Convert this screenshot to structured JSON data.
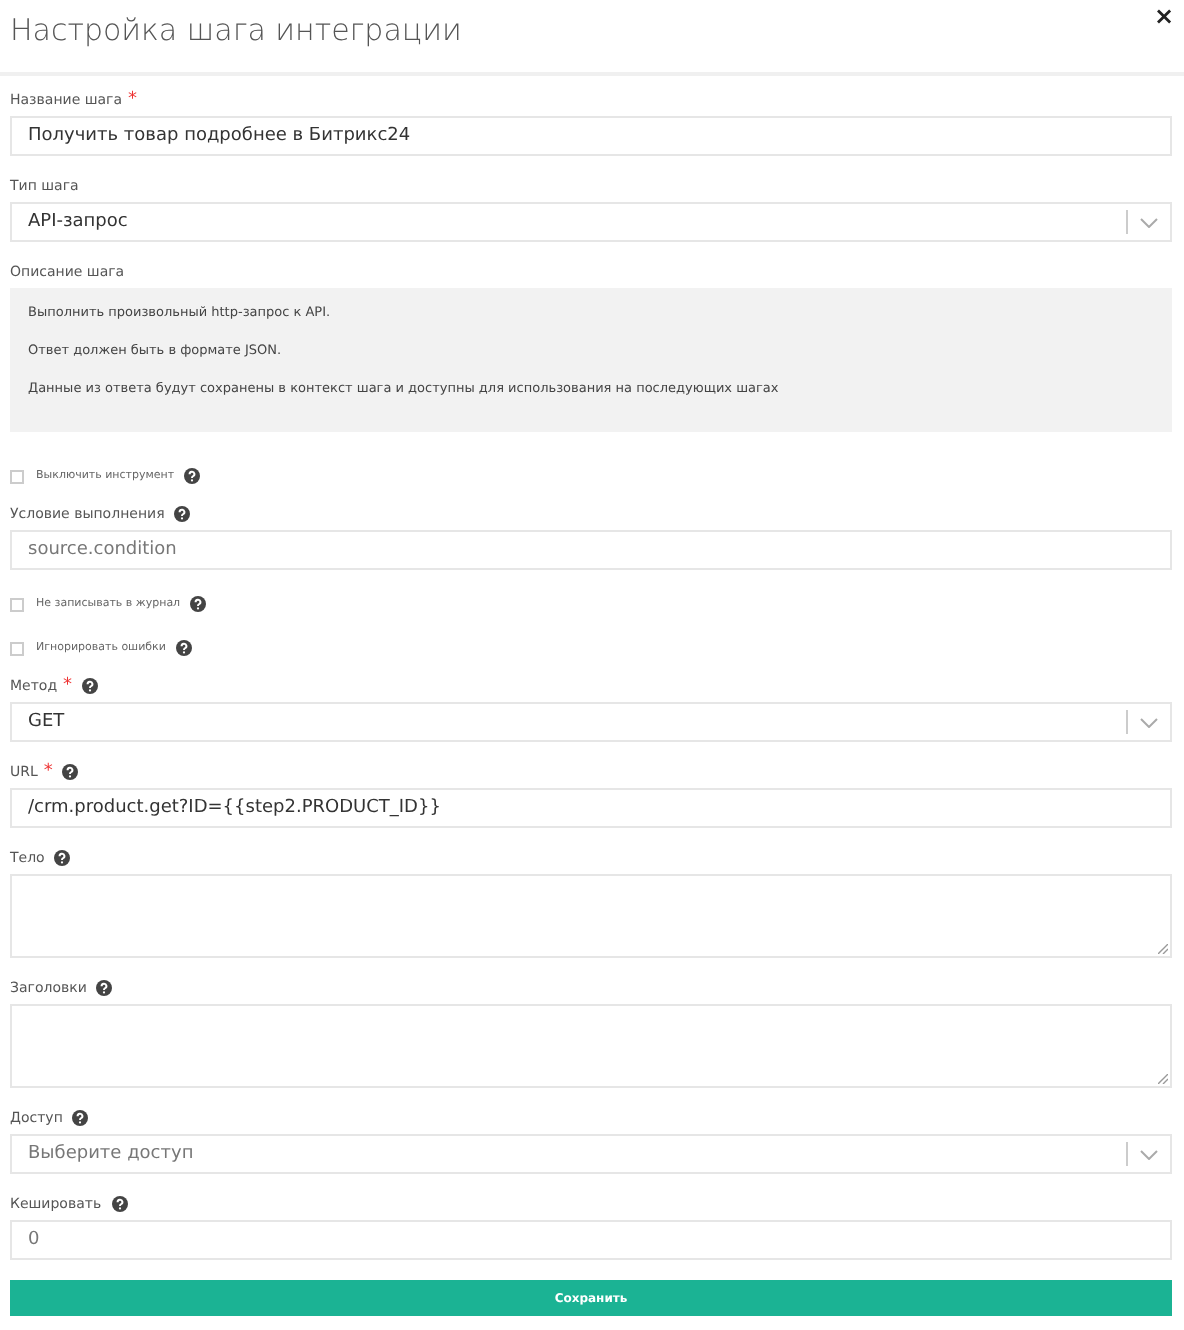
{
  "dialog": {
    "title": "Настройка шага интеграции",
    "close": "×"
  },
  "fields": [
    {
      "kind": "text",
      "label": "Название шага",
      "required_mark": "*",
      "help": false,
      "value": "Получить товар подробнее в Битрикс24"
    },
    {
      "kind": "select",
      "label": "Тип шага",
      "help": false,
      "value": "API-запрос"
    },
    {
      "kind": "description",
      "label": "Описание шага",
      "lines": [
        "Выполнить произвольный http-запрос к API.",
        "Ответ должен быть в формате JSON.",
        "Данные из ответа будут сохранены в контекст шага и доступны для использования на последующих шагах"
      ]
    },
    {
      "kind": "checkbox",
      "label": "Выключить инструмент",
      "help": true,
      "checked": false
    },
    {
      "kind": "text",
      "label": "Условие выполнения",
      "help": true,
      "placeholder": "source.condition"
    },
    {
      "kind": "checkbox",
      "label": "Не записывать в журнал",
      "help": true,
      "checked": false
    },
    {
      "kind": "checkbox",
      "label": "Игнорировать ошибки",
      "help": true,
      "checked": false
    },
    {
      "kind": "select",
      "label": "Метод",
      "required_mark": "*",
      "help": true,
      "value": "GET"
    },
    {
      "kind": "text",
      "label": "URL",
      "required_mark": "*",
      "help": true,
      "value": "/crm.product.get?ID={{step2.PRODUCT_ID}}"
    },
    {
      "kind": "textarea",
      "label": "Тело",
      "help": true
    },
    {
      "kind": "textarea",
      "label": "Заголовки",
      "help": true
    },
    {
      "kind": "select",
      "label": "Доступ",
      "help": true,
      "placeholder": "Выберите доступ"
    },
    {
      "kind": "text",
      "label": "Кешировать",
      "help": true,
      "placeholder": "0"
    }
  ],
  "save_button": "Сохранить"
}
